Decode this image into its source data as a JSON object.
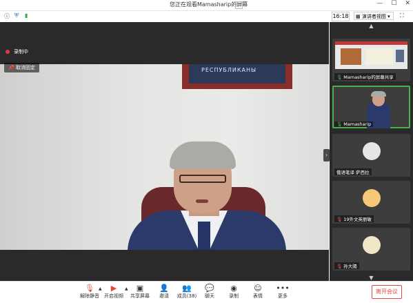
{
  "window": {
    "title": "您正在观看Mamasharip的屏幕"
  },
  "infobar": {
    "time": "16:18",
    "view_button": "演讲者视图"
  },
  "meeting": {
    "recording_label": "录制中",
    "unpin_label": "取消固定",
    "frame_text": "РЕСПУБЛИКАНЫ"
  },
  "sidebar": {
    "tiles": [
      {
        "label": "Mamasharip的屏幕共享",
        "mic": "on"
      },
      {
        "label": "Mamasharip",
        "mic": "on",
        "active": true
      },
      {
        "label": "俄语笔译 萨西拉",
        "mic": "none"
      },
      {
        "label": "19外文英丽敏",
        "mic": "off"
      },
      {
        "label": "孙大陽",
        "mic": "off"
      }
    ]
  },
  "toolbar": {
    "mute": "解除静音",
    "video": "开启视频",
    "share": "共享屏幕",
    "invite": "邀请",
    "participants": "成员(38)",
    "chat": "聊天",
    "record": "录制",
    "reactions": "表情",
    "more": "更多",
    "leave": "离开会议"
  },
  "colors": {
    "accent_green": "#4caf50",
    "leave_red": "#e04a3a",
    "recording_red": "#e03a3a"
  }
}
